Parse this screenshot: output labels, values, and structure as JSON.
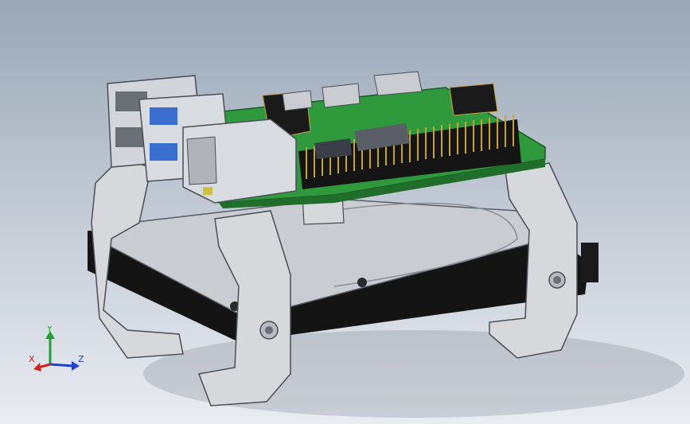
{
  "viewport": {
    "background_top": "#9aa7b7",
    "background_bottom": "#e9ecf1"
  },
  "model": {
    "board_color": "#2f9a3c",
    "bracket_color": "#d6d8dc",
    "drive_color": "#c9ccd1",
    "pad_color": "#141414",
    "header_pin_color": "#c9a23a"
  },
  "triad": {
    "x_label": "X",
    "y_label": "Y",
    "z_label": "Z",
    "x_color": "#d62020",
    "y_color": "#20a030",
    "z_color": "#2040d0"
  }
}
